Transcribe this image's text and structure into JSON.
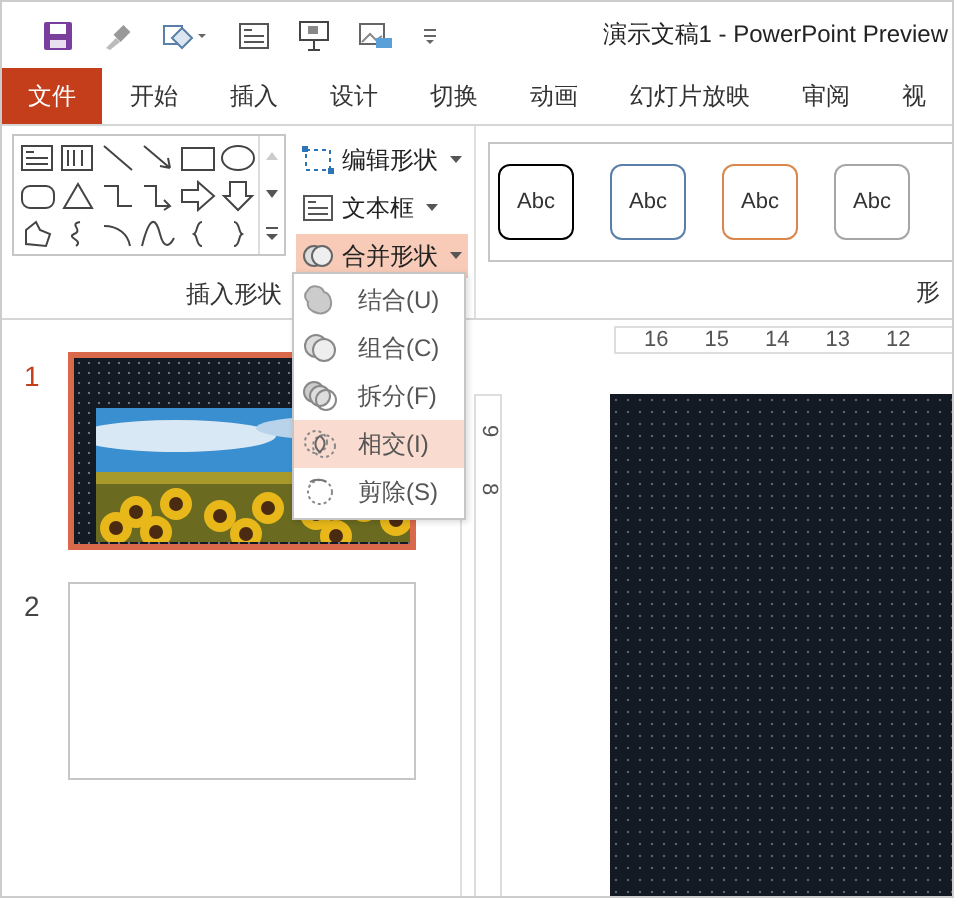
{
  "window": {
    "title": "演示文稿1  -  PowerPoint Preview"
  },
  "tabs": [
    {
      "label": "文件",
      "kind": "file",
      "selected": false
    },
    {
      "label": "开始",
      "kind": "tab",
      "selected": false
    },
    {
      "label": "插入",
      "kind": "tab",
      "selected": false
    },
    {
      "label": "设计",
      "kind": "tab",
      "selected": false
    },
    {
      "label": "切换",
      "kind": "tab",
      "selected": false
    },
    {
      "label": "动画",
      "kind": "tab",
      "selected": false
    },
    {
      "label": "幻灯片放映",
      "kind": "tab",
      "selected": false
    },
    {
      "label": "审阅",
      "kind": "tab",
      "selected": false
    },
    {
      "label": "视",
      "kind": "tab",
      "selected": false
    }
  ],
  "ribbon": {
    "commands": [
      {
        "label": "编辑形状",
        "kind": "edit-shape",
        "active": false
      },
      {
        "label": "文本框",
        "kind": "textbox",
        "active": false
      },
      {
        "label": "合并形状",
        "kind": "merge",
        "active": true
      }
    ],
    "group_label": "插入形状",
    "styles": [
      {
        "label": "Abc",
        "color": "#000000"
      },
      {
        "label": "Abc",
        "color": "#5a7fa8"
      },
      {
        "label": "Abc",
        "color": "#d9874a"
      },
      {
        "label": "Abc",
        "color": "#a6a6a6"
      }
    ],
    "styles_group_label": "形"
  },
  "merge_menu": {
    "items": [
      {
        "label": "结合(U)",
        "kind": "union",
        "selected": false
      },
      {
        "label": "组合(C)",
        "kind": "combine",
        "selected": false
      },
      {
        "label": "拆分(F)",
        "kind": "fragment",
        "selected": false
      },
      {
        "label": "相交(I)",
        "kind": "intersect",
        "selected": true
      },
      {
        "label": "剪除(S)",
        "kind": "subtract",
        "selected": false
      }
    ]
  },
  "slides": [
    {
      "number": "1",
      "selected": true,
      "kind": "picture"
    },
    {
      "number": "2",
      "selected": false,
      "kind": "blank"
    }
  ],
  "ruler": {
    "horizontal": [
      "16",
      "15",
      "14",
      "13",
      "12"
    ],
    "vertical": [
      "9",
      "8"
    ]
  }
}
